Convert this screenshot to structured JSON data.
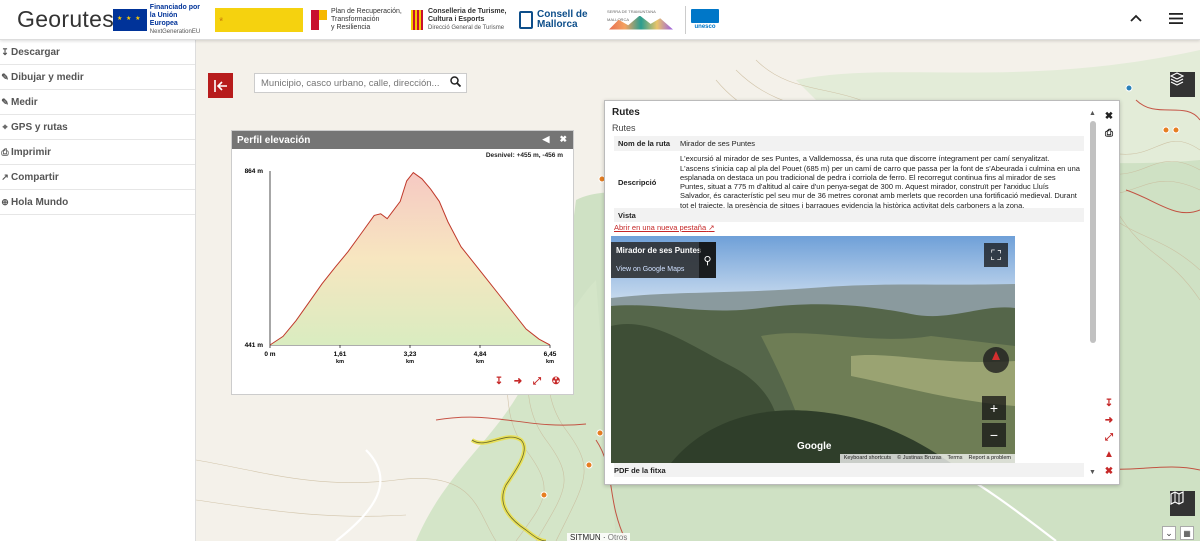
{
  "app": {
    "title": "Georutes"
  },
  "logos": {
    "eu": {
      "line1": "Financiado por",
      "line2": "la Unión Europea",
      "line3": "NextGenerationEU"
    },
    "plan": {
      "line1": "Plan de Recuperación,",
      "line2": "Transformación",
      "line3": "y Resiliencia"
    },
    "conselleria": {
      "line1": "Conselleria de Turisme,",
      "line2": "Cultura i Esports",
      "line3": "Direcció General de Turisme"
    },
    "mallorca": {
      "line1": "Consell de",
      "line2": "Mallorca"
    },
    "tramuntana": {
      "text": "SERRA DE TRAMUNTANA MALLORCA"
    },
    "unesco": {
      "text": "unesco"
    }
  },
  "header_icons": {
    "collapse": "chevron-up-icon",
    "menu": "hamburger-menu-icon"
  },
  "sidebar": {
    "items": [
      {
        "label": "Descargar",
        "icon": "download-icon"
      },
      {
        "label": "Dibujar y medir",
        "icon": "pencil-icon"
      },
      {
        "label": "Medir",
        "icon": "pencil-icon"
      },
      {
        "label": "GPS y rutas",
        "icon": "gps-icon"
      },
      {
        "label": "Imprimir",
        "icon": "printer-icon"
      },
      {
        "label": "Compartir",
        "icon": "share-icon"
      },
      {
        "label": "Hola Mundo",
        "icon": "pin-icon"
      }
    ]
  },
  "search": {
    "placeholder": "Municipio, casco urbano, calle, dirección..."
  },
  "elevation": {
    "title": "Perfil elevación",
    "desnivel": "Desnivel: +455 m, -456 m",
    "ymax": "864 m",
    "ymin": "441 m",
    "xticks": [
      {
        "value": "0 m",
        "unit": ""
      },
      {
        "value": "1,61",
        "unit": "km"
      },
      {
        "value": "3,23",
        "unit": "km"
      },
      {
        "value": "4,84",
        "unit": "km"
      },
      {
        "value": "6,45",
        "unit": "km"
      }
    ]
  },
  "chart_data": {
    "type": "area",
    "title": "Perfil elevación",
    "xlabel": "",
    "ylabel": "",
    "ylim": [
      441,
      864
    ],
    "xlim": [
      0,
      6.45
    ],
    "x": [
      0,
      0.3,
      0.6,
      0.9,
      1.2,
      1.5,
      1.8,
      2.1,
      2.4,
      2.55,
      2.7,
      3.0,
      3.15,
      3.3,
      3.5,
      3.7,
      3.9,
      4.1,
      4.4,
      4.7,
      5.0,
      5.3,
      5.6,
      5.9,
      6.2,
      6.45
    ],
    "series": [
      {
        "values": [
          441,
          462,
          500,
          545,
          590,
          630,
          668,
          712,
          756,
          760,
          748,
          790,
          840,
          860,
          845,
          820,
          790,
          740,
          680,
          640,
          600,
          560,
          520,
          480,
          455,
          441
        ]
      }
    ]
  },
  "rutes": {
    "title": "Rutes",
    "subtitle": "Rutes",
    "nom_label": "Nom de la ruta",
    "nom_value": "Mirador de ses Puntes",
    "desc_label": "Descripció",
    "desc_value": "L'excursió al mirador de ses Puntes, a Valldemossa, és una ruta que discorre íntegrament per camí senyalitzat. L'ascens s'inicia cap al pla del Pouet (685 m) per un camí de carro que passa per la font de s'Abeurada i culmina en una esplanada on destaca un pou tradicional de pedra i corriola de ferro. El recorregut continua fins al mirador de ses Puntes, situat a 775 m d'altitud al caire d'un penya-segat de 300 m. Aquest mirador, construït per l'arxiduc Lluís Salvador, és característic pel seu mur de 36 metres coronat amb merlets que recorden una fortificació medieval. Durant tot el trajecte, la presència de sitges i barraques evidencia la històrica activitat dels carboners a la zona.",
    "vista_label": "Vista",
    "link_text": "Abrir en una nueva pestaña",
    "pdf_label": "PDF de la fitxa"
  },
  "streetview": {
    "place": "Mirador de ses Puntes",
    "view_link": "View on Google Maps",
    "google": "Google",
    "footer": [
      "Keyboard shortcuts",
      "© Justinas Bruzas",
      "Terms",
      "Report a problem"
    ]
  },
  "map": {
    "label_main": "SITMUN",
    "label_sub": "Otros"
  },
  "colors": {
    "accent": "#c62828",
    "header_bg": "#ffffff",
    "panel_head": "#757575",
    "route": "#e8e05a"
  }
}
